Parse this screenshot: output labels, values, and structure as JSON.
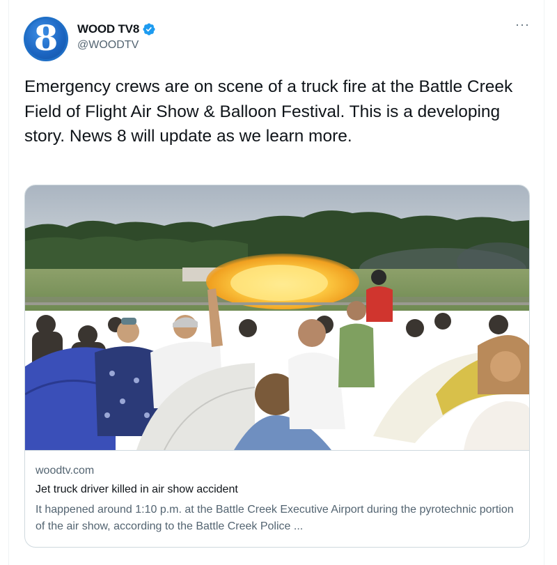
{
  "author": {
    "display_name": "WOOD TV8",
    "handle": "@WOODTV",
    "avatar_text": "8",
    "verified_icon": "verified-badge-icon",
    "verified_color": "#1d9bf0"
  },
  "tweet": {
    "text": "Emergency crews are on scene of a truck fire at the Battle Creek Field of Flight Air Show & Balloon Festival. This is a developing story. News 8 will update as we learn more.",
    "more_label": "···"
  },
  "link_card": {
    "image": "air-show-fireball-crowd-photo",
    "domain": "woodtv.com",
    "title": "Jet truck driver killed in air show accident",
    "description": "It happened around 1:10 p.m. at the Battle Creek Executive Airport during the pyrotechnic portion of the air show, according to the Battle Creek Police ..."
  },
  "colors": {
    "text_primary": "#0f1419",
    "text_secondary": "#536471",
    "border": "#cfd9de",
    "brand_blue": "#1b64c0"
  }
}
